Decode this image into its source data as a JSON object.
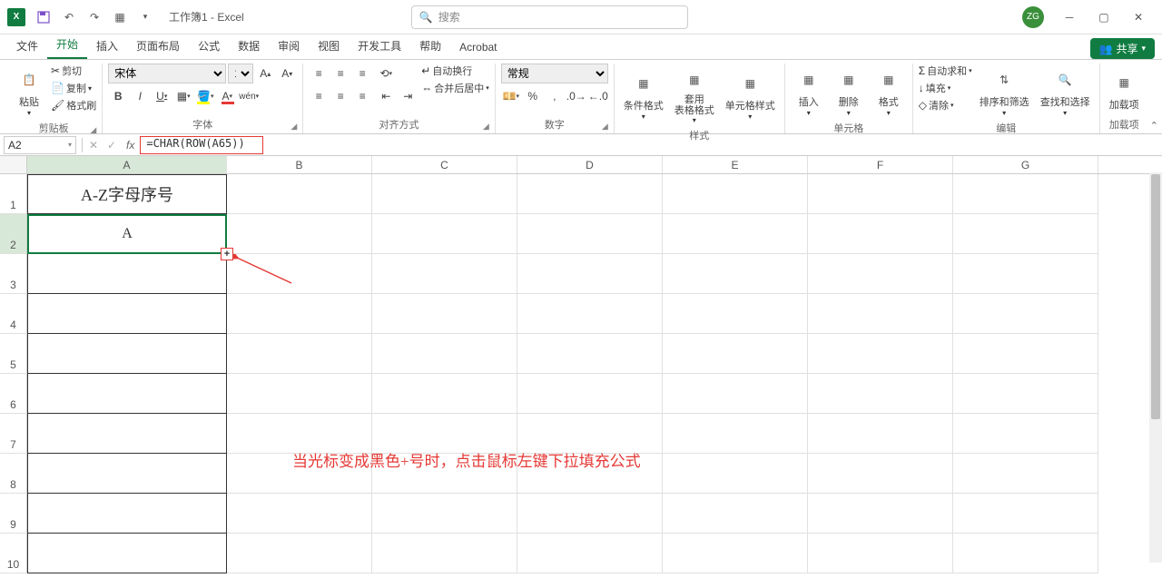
{
  "titlebar": {
    "app_icon_text": "X",
    "title": "工作簿1 - Excel",
    "search_placeholder": "搜索",
    "avatar": "ZG"
  },
  "tabs": {
    "file": "文件",
    "home": "开始",
    "insert": "插入",
    "pagelayout": "页面布局",
    "formulas": "公式",
    "data": "数据",
    "review": "审阅",
    "view": "视图",
    "developer": "开发工具",
    "help": "帮助",
    "acrobat": "Acrobat",
    "share": "共享"
  },
  "ribbon": {
    "clipboard": {
      "paste": "粘贴",
      "cut": "剪切",
      "copy": "复制",
      "painter": "格式刷",
      "group": "剪贴板"
    },
    "font": {
      "name": "宋体",
      "size": "14",
      "group": "字体"
    },
    "align": {
      "wrap": "自动换行",
      "merge": "合并后居中",
      "group": "对齐方式"
    },
    "number": {
      "format": "常规",
      "group": "数字"
    },
    "styles": {
      "cond": "条件格式",
      "table": "套用\n表格格式",
      "cell": "单元格样式",
      "group": "样式"
    },
    "cells": {
      "insert": "插入",
      "delete": "删除",
      "format": "格式",
      "group": "单元格"
    },
    "editing": {
      "sum": "自动求和",
      "fill": "填充",
      "clear": "清除",
      "sort": "排序和筛选",
      "find": "查找和选择",
      "group": "编辑"
    },
    "addin": {
      "label": "加载项",
      "group": "加载项"
    }
  },
  "formulabar": {
    "name": "A2",
    "formula": "=CHAR(ROW(A65))"
  },
  "columns": [
    "A",
    "B",
    "C",
    "D",
    "E",
    "F",
    "G"
  ],
  "rows": [
    "1",
    "2",
    "3",
    "4",
    "5",
    "6",
    "7",
    "8",
    "9",
    "10"
  ],
  "cells": {
    "A1": "A-Z字母序号",
    "A2": "A"
  },
  "annotation": "当光标变成黑色+号时，点击鼠标左键下拉填充公式"
}
